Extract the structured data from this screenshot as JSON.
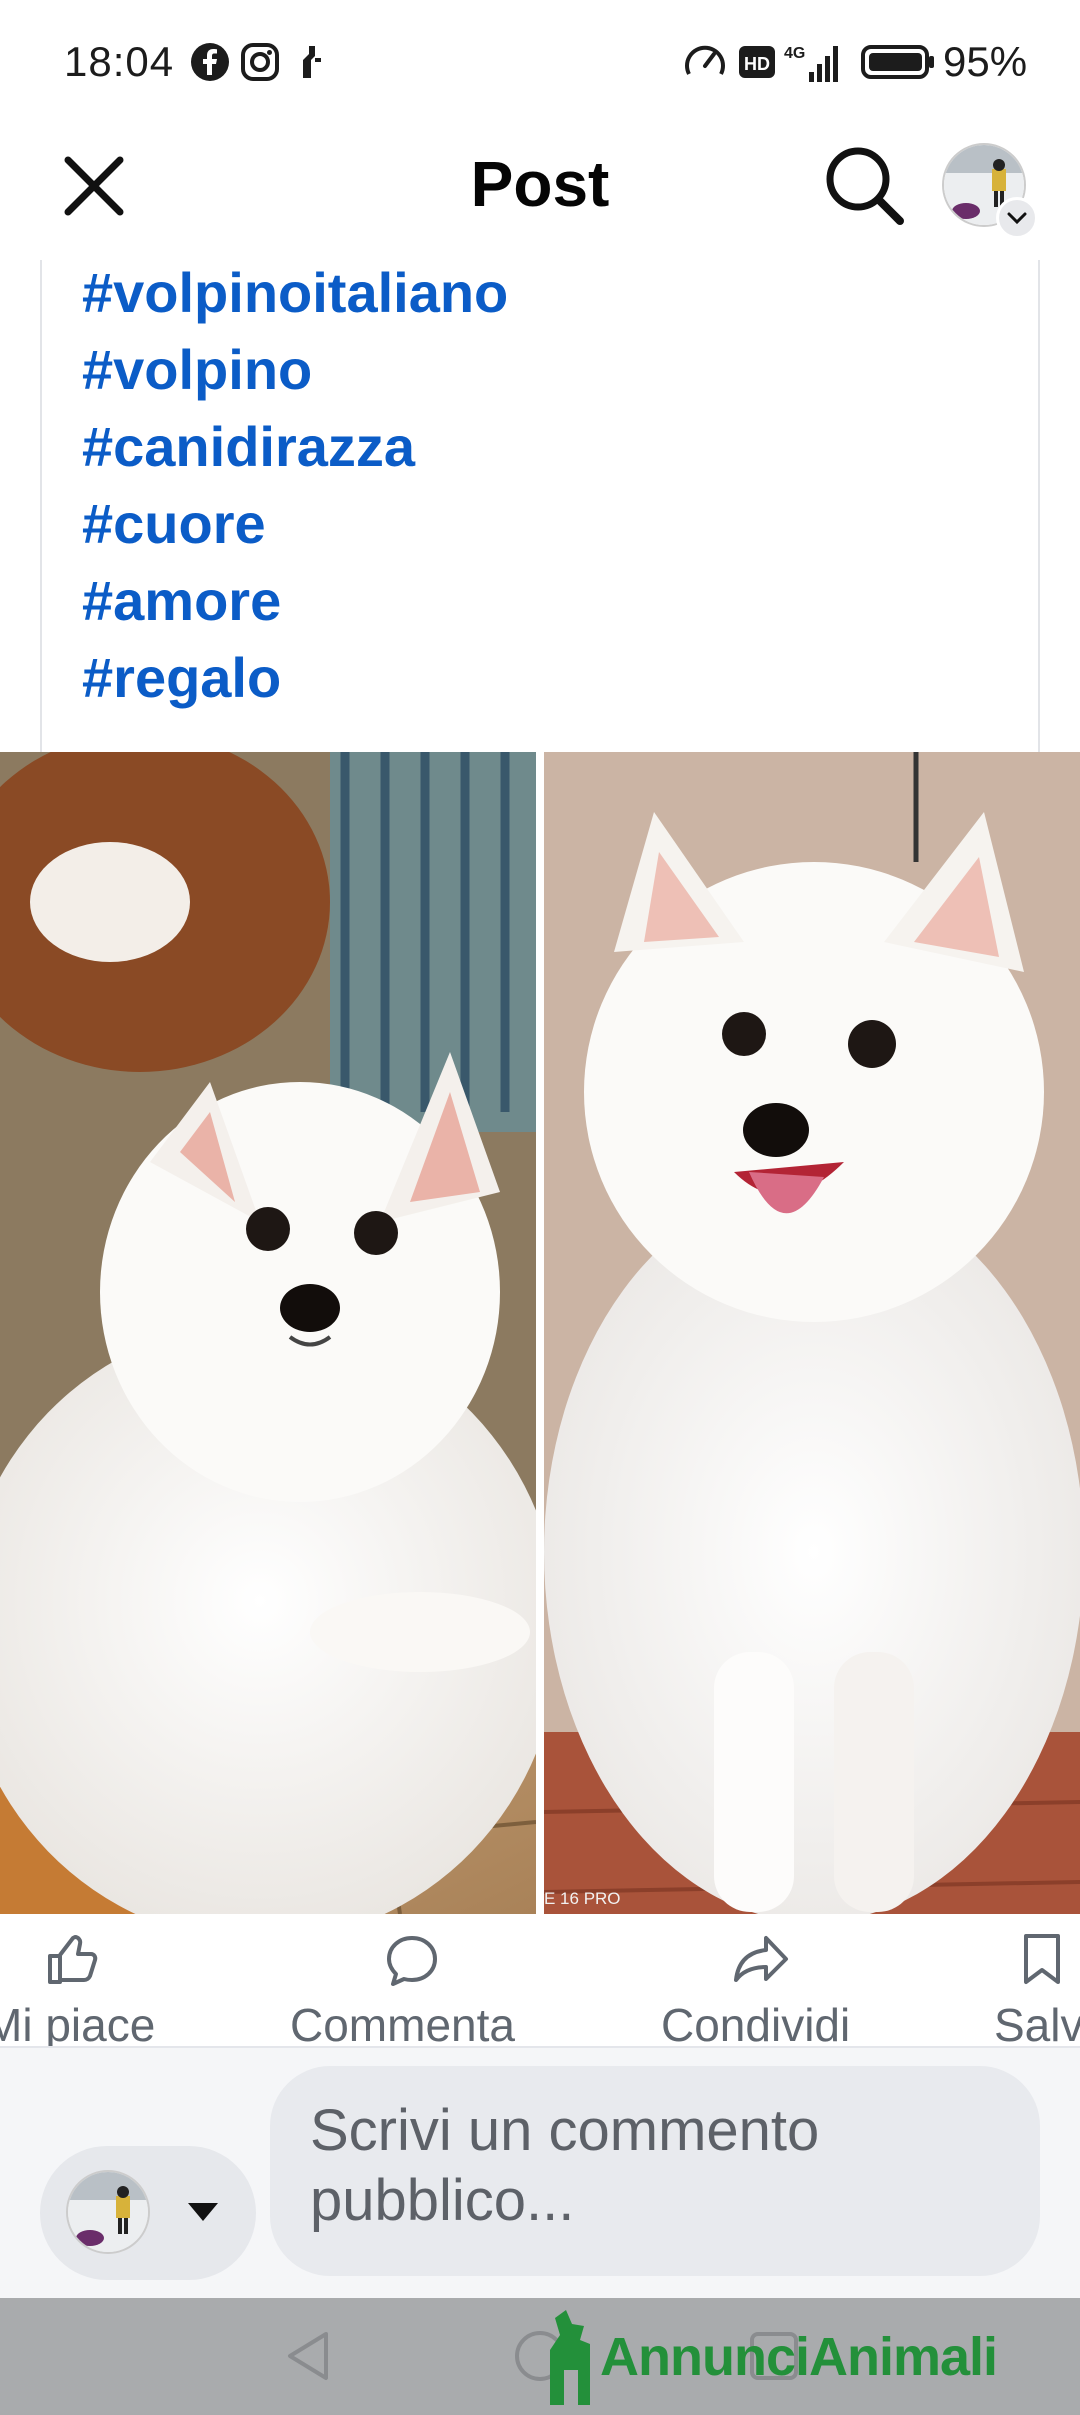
{
  "status_bar": {
    "time": "18:04",
    "notification_icons": [
      "facebook-icon",
      "instagram-icon",
      "app-notification-icon"
    ],
    "system_icons": [
      "data-saver-icon",
      "hd-icon",
      "4g-signal-icon",
      "battery-icon"
    ],
    "network": "4G",
    "battery": "95%"
  },
  "header": {
    "title": "Post",
    "close_icon": "close-icon",
    "search_icon": "search-icon"
  },
  "post": {
    "hashtags": [
      "#volpinoitaliano",
      "#volpino",
      "#canidirazza",
      "#cuore",
      "#amore",
      "#regalo"
    ],
    "photos": [
      {
        "name": "photo-white-volpino-lying"
      },
      {
        "name": "photo-white-volpino-sitting",
        "watermark": "E 16 PRO"
      }
    ]
  },
  "actions": {
    "like": "Mi piace",
    "comment": "Commenta",
    "share": "Condividi",
    "save": "Salva"
  },
  "composer": {
    "placeholder": "Scrivi un commento pubblico..."
  },
  "overlay": {
    "logo_text": "AnnunciAnimali"
  },
  "colors": {
    "hashtag": "#0b5cc7",
    "watermark": "#23903a",
    "nav_bar": "#a9abad"
  }
}
